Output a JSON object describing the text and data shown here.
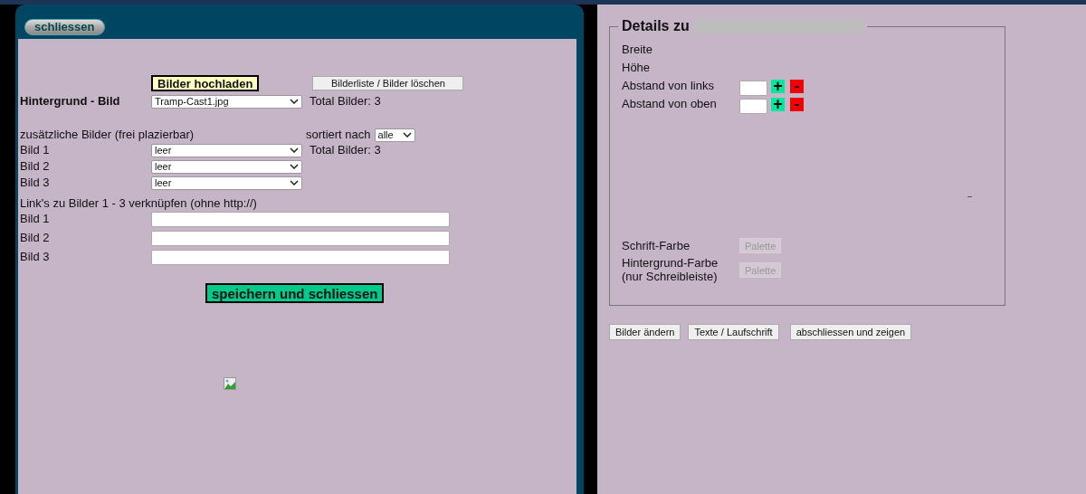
{
  "close_button": "schliessen",
  "upload_button": "Bilder hochladen",
  "image_list_button": "Bilderliste / Bilder löschen",
  "background_image": {
    "label": "Hintergrund - Bild",
    "value": "Tramp-Cast1.jpg",
    "total": "Total Bilder: 3"
  },
  "additional_images": {
    "heading": "zusätzliche Bilder (frei plazierbar)",
    "sort_label": "sortiert nach",
    "sort_value": "alle",
    "total": "Total Bilder: 3",
    "rows": [
      {
        "label": "Bild 1",
        "value": "leer"
      },
      {
        "label": "Bild 2",
        "value": "leer"
      },
      {
        "label": "Bild 3",
        "value": "leer"
      }
    ]
  },
  "links": {
    "heading": "Link's zu Bilder 1 - 3 verknüpfen (ohne http://)",
    "rows": [
      {
        "label": "Bild 1"
      },
      {
        "label": "Bild 2"
      },
      {
        "label": "Bild 3"
      }
    ]
  },
  "save_button": "speichern und schliessen",
  "details": {
    "legend": "Details zu",
    "rows": [
      {
        "kind": "text",
        "label": "Breite"
      },
      {
        "kind": "text",
        "label": "Höhe"
      },
      {
        "kind": "stepper",
        "label": "Abstand von links",
        "plus": "+",
        "minus": "-"
      },
      {
        "kind": "stepper",
        "label": "Abstand von oben",
        "plus": "+",
        "minus": "-"
      }
    ],
    "mark": "–",
    "colors": [
      {
        "label": "Schrift-Farbe",
        "button": "Palette",
        "disabled": true
      },
      {
        "label": "Hintergrund-Farbe\n(nur Schreibleiste)",
        "button": "Palette",
        "disabled": true
      }
    ]
  },
  "bottom_buttons": [
    "Bilder ändern",
    "Texte / Laufschrift",
    "abschliessen und zeigen"
  ]
}
